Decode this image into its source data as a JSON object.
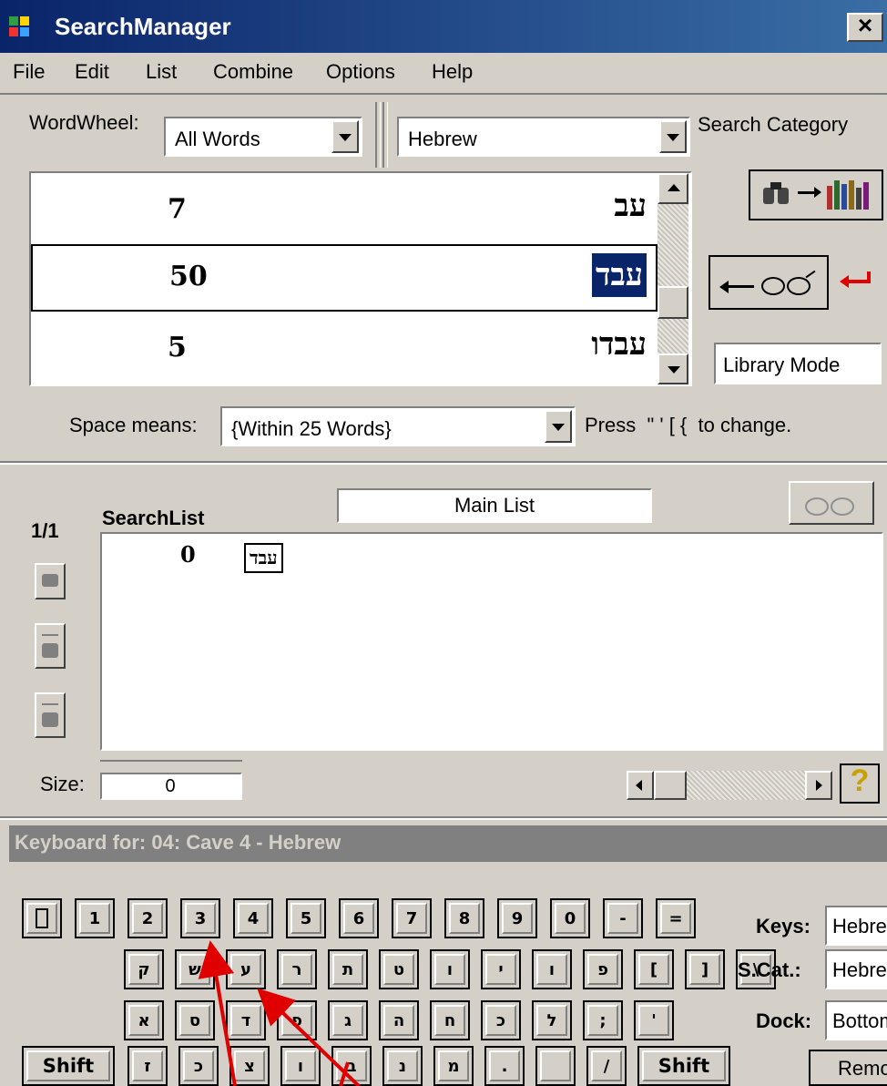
{
  "window": {
    "title": "SearchManager",
    "close_label": "×"
  },
  "menu": [
    "File",
    "Edit",
    "List",
    "Combine",
    "Options",
    "Help"
  ],
  "wordwheel": {
    "label": "WordWheel:",
    "value": "All Words"
  },
  "search_category": {
    "value": "Hebrew",
    "label": "Search Category"
  },
  "word_list": [
    {
      "count": "7",
      "word": "עב"
    },
    {
      "count": "50",
      "word": "עבד",
      "selected": true
    },
    {
      "count": "5",
      "word": "עבדו"
    }
  ],
  "library_mode": "Library Mode",
  "space_means": {
    "label": "Space means:",
    "value": "{Within 25 Words}",
    "hint": "Press  \" ' [ {  to change."
  },
  "searchlist": {
    "counter": "1/1",
    "title": "SearchList",
    "list_name": "Main List",
    "items": [
      {
        "count": "0",
        "word": "עבד"
      }
    ]
  },
  "size": {
    "label": "Size:",
    "value": "0"
  },
  "keyboard": {
    "title": "Keyboard for: 04: Cave 4 - Hebrew",
    "row1": [
      "",
      "1",
      "2",
      "3",
      "4",
      "5",
      "6",
      "7",
      "8",
      "9",
      "0",
      "-",
      "="
    ],
    "row2": [
      "ק",
      "ש",
      "ע",
      "ר",
      "ת",
      "ט",
      "ו",
      "י",
      "ו",
      "פ",
      "[",
      "]",
      "\\"
    ],
    "row3": [
      "א",
      "ס",
      "ד",
      "פ",
      "ג",
      "ה",
      "ח",
      "כ",
      "ל",
      ";",
      "'"
    ],
    "row4": [
      "Shift",
      "ז",
      "כ",
      "צ",
      "ו",
      "ב",
      "נ",
      "מ",
      ".",
      "",
      "/",
      "Shift"
    ],
    "keys_label": "Keys:",
    "keys_value": "Hebrew",
    "scat_label": "S.Cat.:",
    "scat_value": "Hebrew",
    "dock_label": "Dock:",
    "dock_value": "Bottom",
    "remove_label": "Remove"
  },
  "colors": {
    "titlebar_start": "#0a246a",
    "titlebar_end": "#3a6ea5",
    "selection": "#0a246a",
    "face": "#d4d0c8",
    "arrow": "#e00000"
  }
}
